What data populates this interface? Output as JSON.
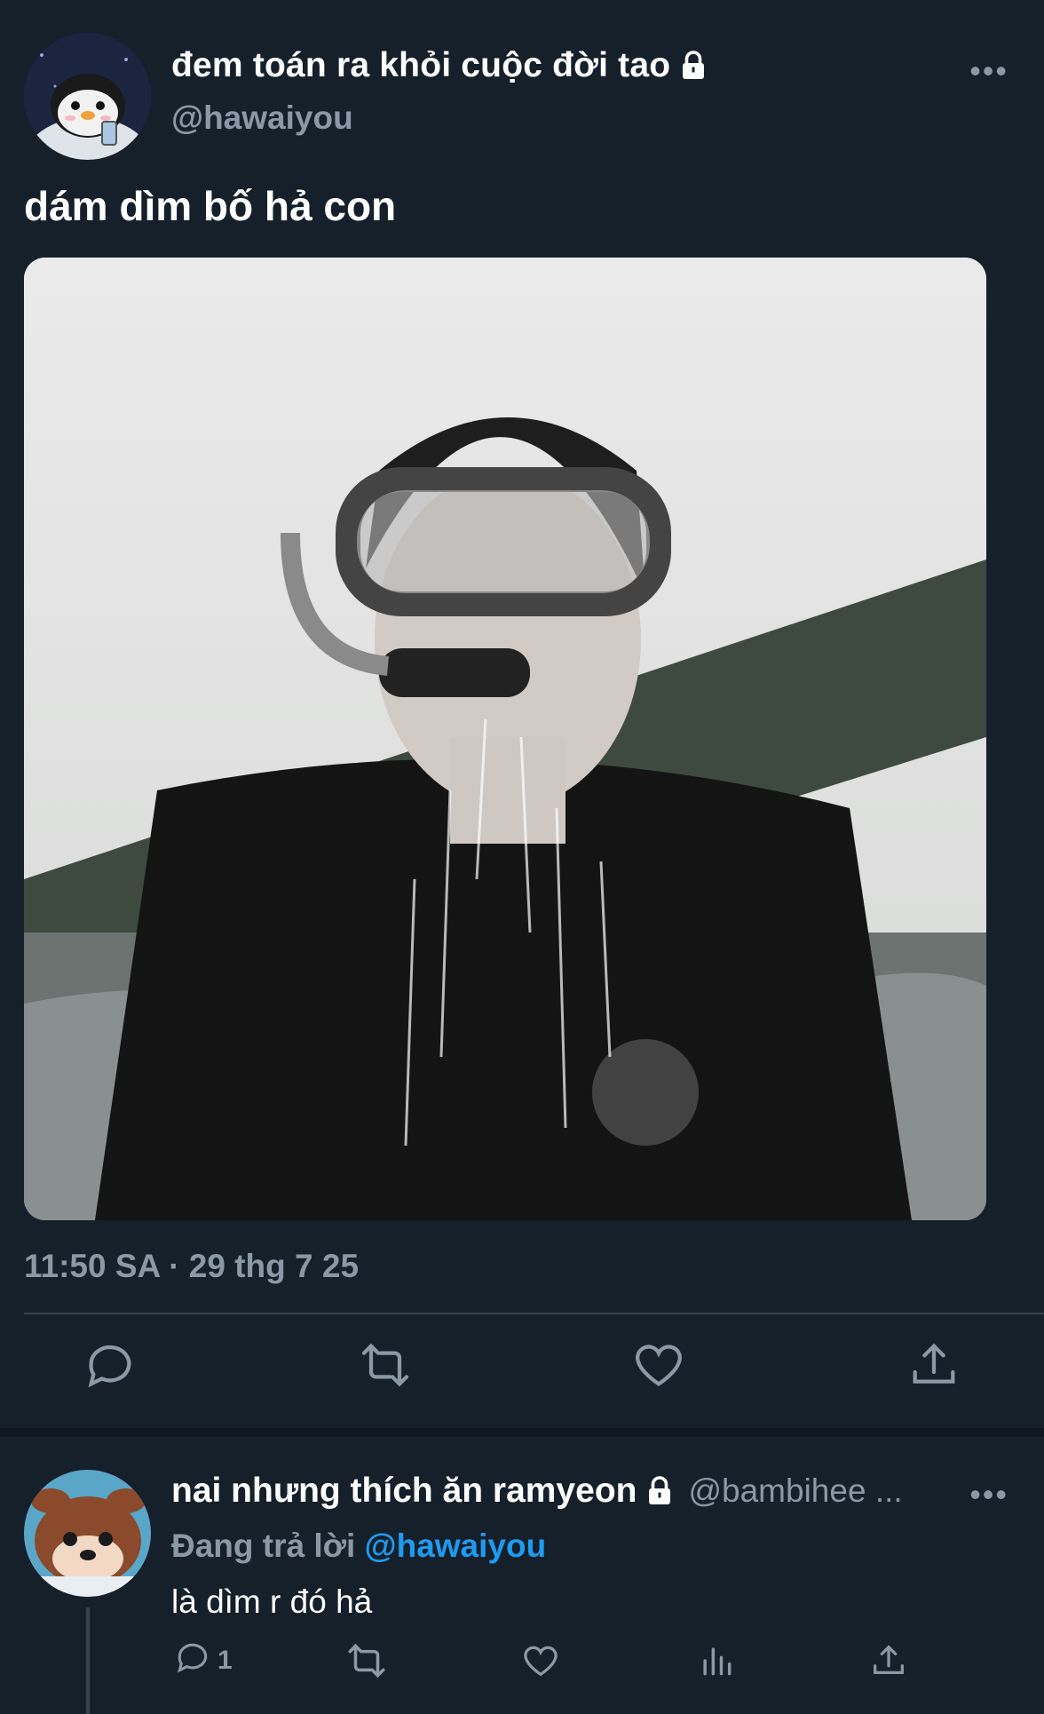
{
  "tweet": {
    "display_name": "đem toán ra khỏi cuộc đời tao",
    "handle": "@hawaiyou",
    "text": "dám dìm bố hả con",
    "timestamp": "11:50 SA · 29 thg 7 25",
    "avatar_icon": "penguin-avatar-icon",
    "media_description": "photo"
  },
  "actions": {
    "reply_icon": "reply-icon",
    "retweet_icon": "retweet-icon",
    "like_icon": "like-icon",
    "share_icon": "share-icon"
  },
  "reply": {
    "display_name": "nai nhưng thích ăn ramyeon",
    "handle": "@bambihee ...",
    "replying_prefix": "Đang trả lời",
    "replying_to": "@hawaiyou",
    "text": "là dìm r đó hả",
    "reply_count": "1",
    "avatar_icon": "deer-avatar-icon"
  },
  "more_glyph": "•••",
  "colors": {
    "background": "#15202b",
    "secondary_text": "#8b98a5",
    "accent": "#1d9bf0",
    "divider": "#38444d"
  }
}
